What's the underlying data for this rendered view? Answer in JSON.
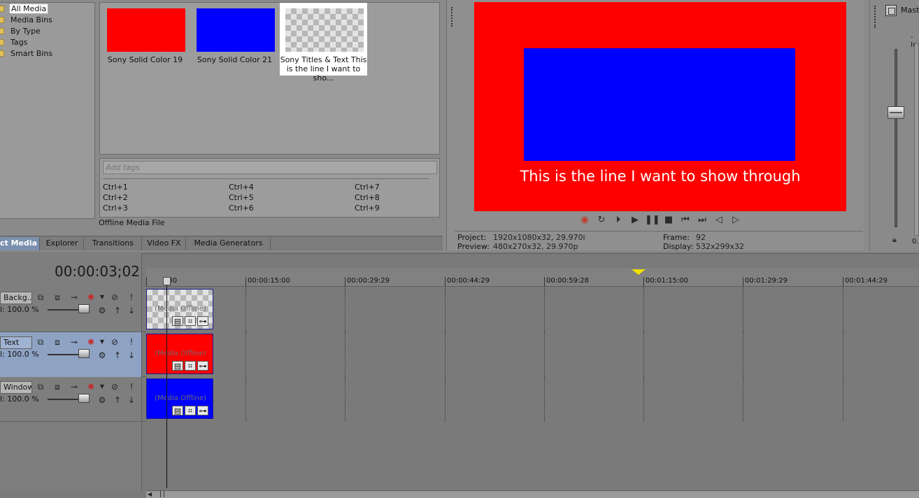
{
  "explorer_tree": {
    "items": [
      {
        "label": "All Media",
        "selected": true
      },
      {
        "label": "Media Bins",
        "selected": false
      },
      {
        "label": "By Type",
        "selected": false
      },
      {
        "label": "Tags",
        "selected": false
      },
      {
        "label": "Smart Bins",
        "selected": false
      }
    ]
  },
  "media": {
    "items": [
      {
        "caption": "Sony Solid Color 19",
        "color": "#ff0000"
      },
      {
        "caption": "Sony Solid Color 21",
        "color": "#0000ff"
      },
      {
        "caption": "Sony Titles & Text This is the line I want to sho...",
        "selected": true
      }
    ]
  },
  "tags": {
    "placeholder": "Add tags",
    "shortcuts": [
      "Ctrl+1",
      "Ctrl+2",
      "Ctrl+3",
      "Ctrl+4",
      "Ctrl+5",
      "Ctrl+6",
      "Ctrl+7",
      "Ctrl+8",
      "Ctrl+9"
    ]
  },
  "status": {
    "text": "Offline Media File"
  },
  "tabs": [
    {
      "label": "ct Media",
      "active": true
    },
    {
      "label": "Explorer"
    },
    {
      "label": "Transitions"
    },
    {
      "label": "Video FX"
    },
    {
      "label": "Media Generators"
    }
  ],
  "preview": {
    "title_text": "This is the line I want to show through",
    "background_color": "#ff0000",
    "inner_color": "#0000ff",
    "info": {
      "project_label": "Project:",
      "project_value": "1920x1080x32, 29.970i",
      "preview_label": "Preview:",
      "preview_value": "480x270x32, 29.970p",
      "frame_label": "Frame:",
      "frame_value": "92",
      "display_label": "Display:",
      "display_value": "532x299x32"
    }
  },
  "master": {
    "label": "Maste",
    "value": "0.",
    "minus": "-In"
  },
  "timeline": {
    "timecode": "00:00:03;02",
    "ruler": [
      "00:00:00:00",
      "00:00:15:00",
      "00:00:29:29",
      "00:00:44:29",
      "00:00:59:28",
      "00:01:15:00",
      "00:01:29:29",
      "00:01:44:29"
    ],
    "ruler_first_visible": ":00",
    "tracks": [
      {
        "name": "Backg...",
        "level": "l: 100.0 %",
        "clip_label": "(Media Offline)",
        "clip_fill": "checker",
        "selected": false
      },
      {
        "name": "Text",
        "level": "l: 100.0 %",
        "clip_label": "(Media Offline)",
        "clip_fill": "#ff0000",
        "selected": true
      },
      {
        "name": "Window",
        "level": "l: 100.0 %",
        "clip_label": "(Media Offline)",
        "clip_fill": "#0000ff",
        "selected": false
      }
    ]
  }
}
